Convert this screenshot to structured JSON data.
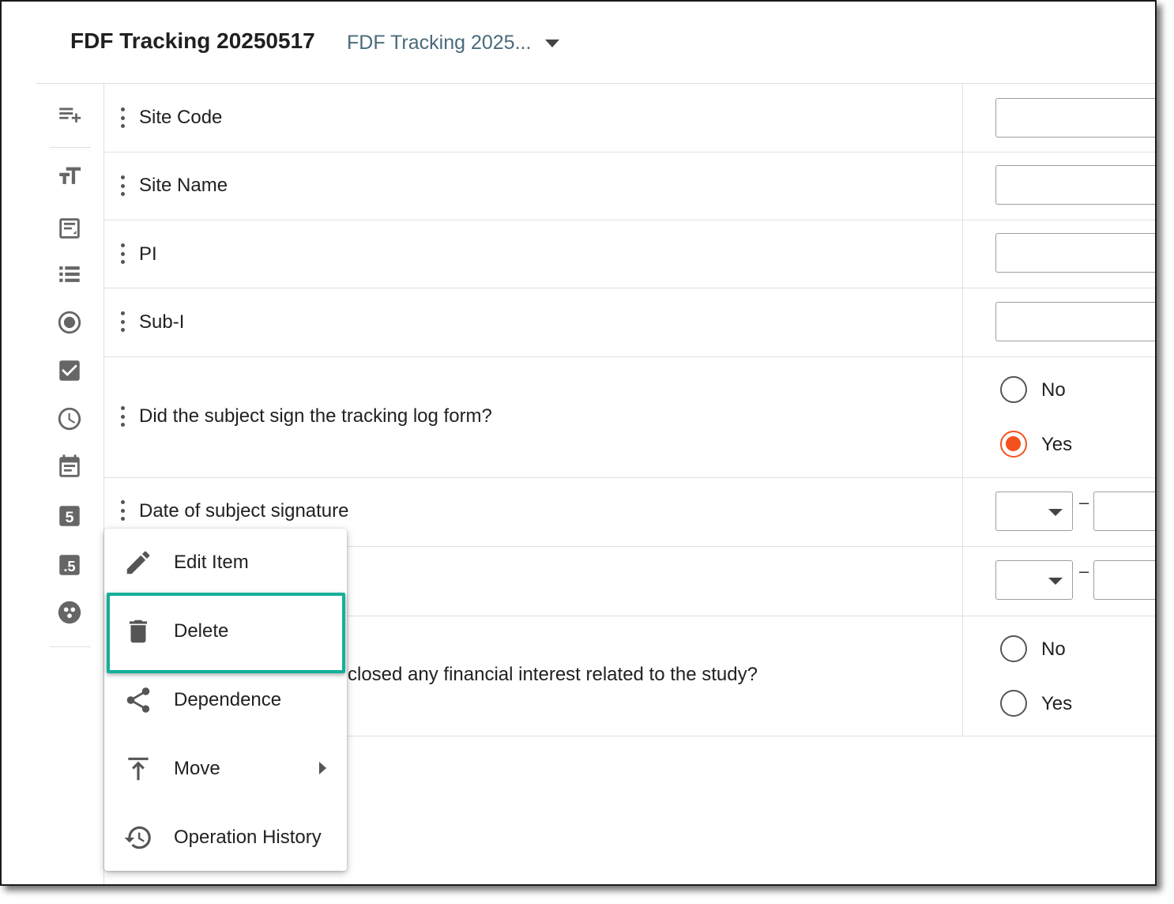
{
  "header": {
    "form_title": "FDF Tracking 20250517",
    "version_selector": "FDF Tracking 2025..."
  },
  "toolbar": {
    "items": [
      {
        "name": "add-list-icon",
        "label": ""
      },
      {
        "name": "text-size-icon",
        "label": ""
      },
      {
        "name": "text-field-icon",
        "label": ""
      },
      {
        "name": "list-icon",
        "label": ""
      },
      {
        "name": "radio-icon",
        "label": ""
      },
      {
        "name": "checkbox-icon",
        "label": ""
      },
      {
        "name": "clock-icon",
        "label": ""
      },
      {
        "name": "calendar-icon",
        "label": ""
      },
      {
        "name": "number-icon",
        "label": "5"
      },
      {
        "name": "decimal-icon",
        "label": ".5"
      },
      {
        "name": "group-icon",
        "label": ""
      }
    ]
  },
  "rows": [
    {
      "label": "Site Code",
      "control": "text"
    },
    {
      "label": "Site Name",
      "control": "text"
    },
    {
      "label": "PI",
      "control": "text"
    },
    {
      "label": "Sub-I",
      "control": "text"
    },
    {
      "label": "Did the subject sign the tracking log form?",
      "control": "radio",
      "options": [
        "No",
        "Yes"
      ],
      "selected": "Yes"
    },
    {
      "label": "Date of subject signature",
      "control": "date"
    },
    {
      "label": "",
      "control": "date"
    },
    {
      "label_partial": "closed any financial interest related to the study?",
      "control": "radio",
      "options": [
        "No",
        "Yes"
      ],
      "selected": ""
    }
  ],
  "date_separator": "–",
  "context_menu": {
    "items": [
      {
        "label": "Edit Item",
        "icon": "pencil-icon"
      },
      {
        "label": "Delete",
        "icon": "trash-icon",
        "highlighted": true
      },
      {
        "label": "Dependence",
        "icon": "share-icon"
      },
      {
        "label": "Move",
        "icon": "move-to-top-icon",
        "submenu": true
      },
      {
        "label": "Operation History",
        "icon": "history-icon"
      }
    ]
  },
  "colors": {
    "accent_radio": "#f4511e",
    "highlight_border": "#13b09a",
    "version_text": "#4a6a7a"
  }
}
